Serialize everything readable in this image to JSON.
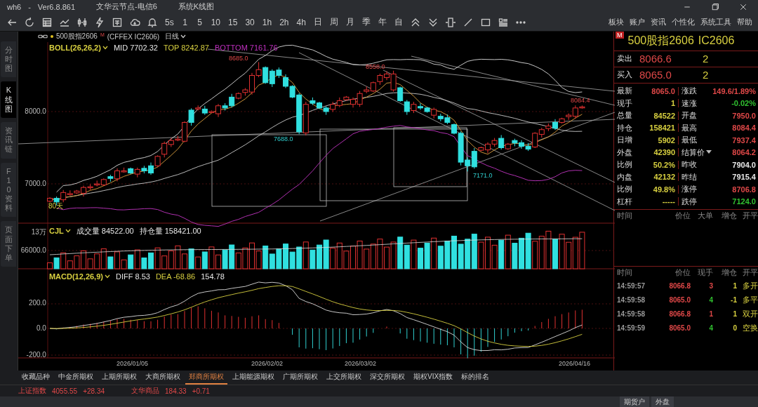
{
  "window": {
    "title": "wh6",
    "separator": "-",
    "version": "Ver6.8.861",
    "server": "文华云节点-电信6",
    "view": "系统K线图"
  },
  "toolbar": {
    "periods": [
      "5s",
      "1",
      "5",
      "10",
      "15",
      "30",
      "1h",
      "2h",
      "4h",
      "日",
      "周",
      "月",
      "季",
      "年",
      "自"
    ],
    "menus": [
      "板块",
      "账户",
      "资讯",
      "个性化",
      "系统工具",
      "帮助"
    ]
  },
  "chart_header": {
    "symbol": "500股指2606",
    "badge": "M",
    "exchange": "(CFFEX IC2606)",
    "period": "日线"
  },
  "side_tabs": [
    {
      "label": "分时图",
      "selected": false
    },
    {
      "label": "K线图",
      "selected": true
    },
    {
      "label": "资讯链",
      "selected": false
    },
    {
      "label": "F10资料",
      "selected": false
    },
    {
      "label": "页面下单",
      "selected": false
    }
  ],
  "chart": {
    "legends": [
      [
        {
          "text": "BOLL(26,26,2)",
          "color": "#d8d040",
          "dropdown": true
        },
        {
          "text": "MID 7702.32",
          "color": "#e8e8e8",
          "dropdown": false
        },
        {
          "text": "TOP 8242.87",
          "color": "#d8d040",
          "dropdown": false
        },
        {
          "text": "BOTTOM 7161.76",
          "color": "#c030c0",
          "dropdown": false
        }
      ],
      [
        {
          "text": "CJL",
          "color": "#d8d040",
          "dropdown": true
        },
        {
          "text": "成交量 84522.00",
          "color": "#e8e8e8",
          "dropdown": false
        },
        {
          "text": "持仓量 158421.00",
          "color": "#e8e8e8",
          "dropdown": false
        }
      ],
      [
        {
          "text": "MACD(12,26,9)",
          "color": "#d8d040",
          "dropdown": true
        },
        {
          "text": "DIFF 8.53",
          "color": "#e8e8e8",
          "dropdown": false
        },
        {
          "text": "DEA -68.86",
          "color": "#d8d040",
          "dropdown": false
        },
        {
          "text": "154.78",
          "color": "#e8e8e8",
          "dropdown": false
        }
      ]
    ],
    "axis_labels": [
      "8000.0",
      "7000.0",
      "13万",
      "66000.0",
      "200.0",
      "0.0",
      "-200.0"
    ],
    "annotations": [
      {
        "text": "8685.0",
        "kind": "high"
      },
      {
        "text": "8558.0",
        "kind": "high"
      },
      {
        "text": "8084.4",
        "kind": "high"
      },
      {
        "text": "7688.0",
        "kind": "low"
      },
      {
        "text": "7171.0",
        "kind": "low"
      },
      {
        "text": "80天",
        "kind": "note"
      }
    ],
    "dates": [
      "2026/01/05",
      "2026/02/02",
      "2026/03/02",
      "2026/04/16"
    ]
  },
  "quote": {
    "badge": "M",
    "name": "500股指2606",
    "code": "IC2606",
    "book": [
      {
        "label": "卖出",
        "price": "8066.6",
        "volume": "2"
      },
      {
        "label": "买入",
        "price": "8065.0",
        "volume": "2"
      }
    ],
    "stats": [
      [
        {
          "label": "最新",
          "value": "8065.0",
          "color": "#e04848",
          "dropdown": false
        },
        {
          "label": "涨跌",
          "value": "149.6/1.89%",
          "color": "#e04848",
          "dropdown": false
        }
      ],
      [
        {
          "label": "现手",
          "value": "1",
          "color": "#d8d040",
          "dropdown": false
        },
        {
          "label": "速涨",
          "value": "-0.02%",
          "color": "#30c030",
          "dropdown": false
        }
      ],
      [
        {
          "label": "总量",
          "value": "84522",
          "color": "#d8d040",
          "dropdown": false
        },
        {
          "label": "开盘",
          "value": "7950.0",
          "color": "#e04848",
          "dropdown": false
        }
      ],
      [
        {
          "label": "持仓",
          "value": "158421",
          "color": "#d8d040",
          "dropdown": false
        },
        {
          "label": "最高",
          "value": "8084.4",
          "color": "#e04848",
          "dropdown": false
        }
      ],
      [
        {
          "label": "日增",
          "value": "5902",
          "color": "#d8d040",
          "dropdown": false
        },
        {
          "label": "最低",
          "value": "7937.4",
          "color": "#e04848",
          "dropdown": false
        }
      ],
      [
        {
          "label": "外盘",
          "value": "42390",
          "color": "#d8d040",
          "dropdown": false
        },
        {
          "label": "结算价",
          "value": "8064.2",
          "color": "#e04848",
          "dropdown": true
        }
      ],
      [
        {
          "label": "比例",
          "value": "50.2%",
          "color": "#d8d040",
          "dropdown": false
        },
        {
          "label": "昨收",
          "value": "7904.0",
          "color": "#e8e8e8",
          "dropdown": false
        }
      ],
      [
        {
          "label": "内盘",
          "value": "42132",
          "color": "#d8d040",
          "dropdown": false
        },
        {
          "label": "昨结",
          "value": "7915.4",
          "color": "#e8e8e8",
          "dropdown": false
        }
      ],
      [
        {
          "label": "比例",
          "value": "49.8%",
          "color": "#d8d040",
          "dropdown": false
        },
        {
          "label": "涨停",
          "value": "8706.8",
          "color": "#e04848",
          "dropdown": false
        }
      ],
      [
        {
          "label": "杠杆",
          "value": "-----",
          "color": "#d8d040",
          "dropdown": false
        },
        {
          "label": "跌停",
          "value": "7124.0",
          "color": "#30c030",
          "dropdown": false
        }
      ]
    ],
    "big_orders_columns": [
      "时间",
      "价位",
      "大单",
      "增仓",
      "开平"
    ],
    "ticks_columns": [
      "时间",
      "价位",
      "现手",
      "增仓",
      "开平"
    ],
    "ticks": [
      {
        "time": "14:59:57",
        "price": "8066.8",
        "hand": "3",
        "color": "#e04848",
        "change": "1",
        "action": "多开"
      },
      {
        "time": "14:59:58",
        "price": "8065.0",
        "hand": "4",
        "color": "#30c030",
        "change": "-1",
        "action": "多平"
      },
      {
        "time": "14:59:58",
        "price": "8066.8",
        "hand": "1",
        "color": "#e04848",
        "change": "1",
        "action": "双开"
      },
      {
        "time": "14:59:59",
        "price": "8065.0",
        "hand": "4",
        "color": "#30c030",
        "change": "0",
        "action": "空换"
      }
    ]
  },
  "exchange_tabs": [
    {
      "label": "收藏品种",
      "selected": false
    },
    {
      "label": "中金所期权",
      "selected": false
    },
    {
      "label": "上期所期权",
      "selected": false
    },
    {
      "label": "大商所期权",
      "selected": false
    },
    {
      "label": "郑商所期权",
      "selected": true
    },
    {
      "label": "上期能源期权",
      "selected": false
    },
    {
      "label": "广期所期权",
      "selected": false
    },
    {
      "label": "上交所期权",
      "selected": false
    },
    {
      "label": "深交所期权",
      "selected": false
    },
    {
      "label": "期权VIX指数",
      "selected": false
    },
    {
      "label": "标的排名",
      "selected": false
    }
  ],
  "indices": [
    {
      "name": "上证指数",
      "value": "4055.55",
      "change": "+28.34"
    },
    {
      "name": "文华商品",
      "value": "184.33",
      "change": "+0.71"
    }
  ],
  "status_bar": {
    "buttons": [
      "期货户",
      "外盘"
    ]
  }
}
